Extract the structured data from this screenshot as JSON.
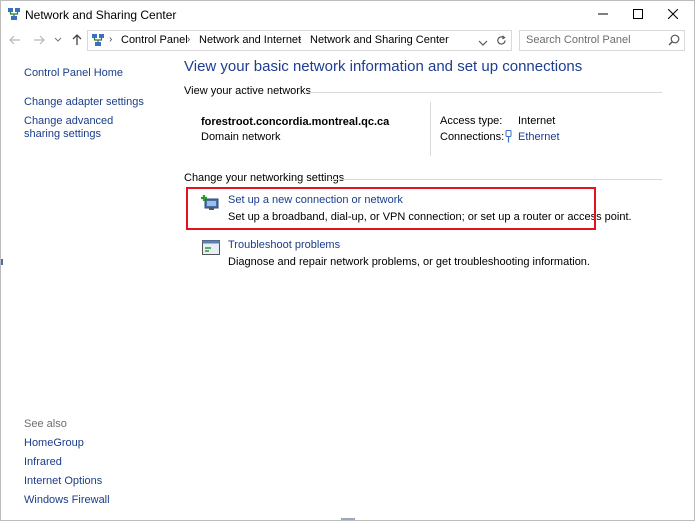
{
  "window": {
    "title": "Network and Sharing Center",
    "minimize_icon": "minimize-icon",
    "maximize_icon": "maximize-icon",
    "close_icon": "close-icon"
  },
  "address_bar": {
    "breadcrumbs": [
      "Control Panel",
      "Network and Internet",
      "Network and Sharing Center"
    ],
    "search_placeholder": "Search Control Panel"
  },
  "left_pane": {
    "links": [
      "Control Panel Home",
      "Change adapter settings",
      "Change advanced sharing settings"
    ],
    "see_also_label": "See also",
    "see_also": [
      "HomeGroup",
      "Infrared",
      "Internet Options",
      "Windows Firewall"
    ]
  },
  "main": {
    "heading": "View your basic network information and set up connections",
    "active_networks_label": "View your active networks",
    "network": {
      "name": "forestroot.concordia.montreal.qc.ca",
      "type": "Domain network",
      "access_type_label": "Access type:",
      "access_type_value": "Internet",
      "connections_label": "Connections:",
      "connections_value": "Ethernet"
    },
    "change_settings_label": "Change your networking settings",
    "tasks": [
      {
        "title": "Set up a new connection or network",
        "description": "Set up a broadband, dial-up, or VPN connection; or set up a router or access point.",
        "icon": "new-connection-icon"
      },
      {
        "title": "Troubleshoot problems",
        "description": "Diagnose and repair network problems, or get troubleshooting information.",
        "icon": "troubleshoot-icon"
      }
    ]
  },
  "colors": {
    "link": "#1a3d8a",
    "heading": "#1e3d92",
    "highlight_border": "#e0141e"
  }
}
